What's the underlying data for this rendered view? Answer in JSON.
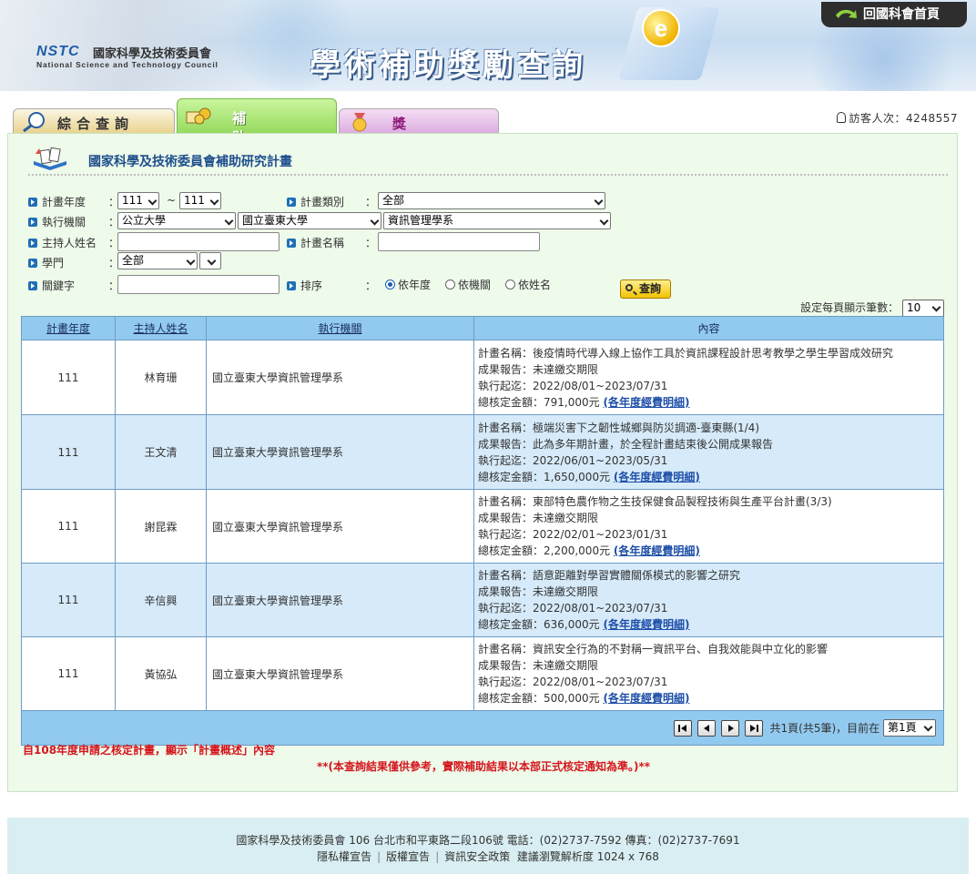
{
  "header": {
    "logo_mark": "NSTC",
    "logo_cn": "國家科學及技術委員會",
    "logo_en": "National Science and Technology Council",
    "site_title": "學術補助獎勵查詢",
    "home_button": "回國科會首頁"
  },
  "tabs": [
    {
      "label": "綜合查詢",
      "icon": "magnifier-icon"
    },
    {
      "label": "補　助",
      "icon": "money-icon"
    },
    {
      "label": "獎　勵",
      "icon": "medal-icon"
    }
  ],
  "visitor": {
    "label": "訪客人次：4248557"
  },
  "panel": {
    "title": "國家科學及技術委員會補助研究計畫"
  },
  "form": {
    "year_label": "計畫年度",
    "year_from": "111",
    "year_sep": "~",
    "year_to": "111",
    "type_label": "計畫類別",
    "type_value": "全部",
    "org_label": "執行機關",
    "org_kind": "公立大學",
    "org_school": "國立臺東大學",
    "org_dept": "資訊管理學系",
    "pi_label": "主持人姓名",
    "pi_value": "",
    "plan_name_label": "計畫名稱",
    "plan_name_value": "",
    "field_label": "學門",
    "field_value": "全部",
    "keyword_label": "關鍵字",
    "keyword_value": "",
    "sort_label": "排序",
    "sort_options": [
      "依年度",
      "依機關",
      "依姓名"
    ],
    "sort_selected": "依年度",
    "search_button": "查詢",
    "colon": "："
  },
  "perpage": {
    "label": "設定每頁顯示筆數：",
    "value": "10"
  },
  "table": {
    "headers": [
      "計畫年度",
      "主持人姓名",
      "執行機關",
      "內容"
    ],
    "rows": [
      {
        "year": "111",
        "pi": "林育珊",
        "org": "國立臺東大學資訊管理學系",
        "plan": "計畫名稱：後疫情時代導入線上協作工具於資訊課程設計思考教學之學生學習成效研究",
        "report": "成果報告：未達繳交期限",
        "period": "執行起迄：2022/08/01~2023/07/31",
        "amount": "總核定金額：791,000元",
        "detail": "(各年度經費明細)"
      },
      {
        "year": "111",
        "pi": "王文清",
        "org": "國立臺東大學資訊管理學系",
        "plan": "計畫名稱：極端災害下之韌性城鄉與防災調適-臺東縣(1/4)",
        "report": "成果報告：此為多年期計畫，於全程計畫結束後公開成果報告",
        "period": "執行起迄：2022/06/01~2023/05/31",
        "amount": "總核定金額：1,650,000元",
        "detail": "(各年度經費明細)"
      },
      {
        "year": "111",
        "pi": "謝昆霖",
        "org": "國立臺東大學資訊管理學系",
        "plan": "計畫名稱：東部特色農作物之生技保健食品製程技術與生產平台計畫(3/3)",
        "report": "成果報告：未達繳交期限",
        "period": "執行起迄：2022/02/01~2023/01/31",
        "amount": "總核定金額：2,200,000元",
        "detail": "(各年度經費明細)"
      },
      {
        "year": "111",
        "pi": "辛信興",
        "org": "國立臺東大學資訊管理學系",
        "plan": "計畫名稱：語意距離對學習實體關係模式的影響之研究",
        "report": "成果報告：未達繳交期限",
        "period": "執行起迄：2022/08/01~2023/07/31",
        "amount": "總核定金額：636,000元",
        "detail": "(各年度經費明細)"
      },
      {
        "year": "111",
        "pi": "黃協弘",
        "org": "國立臺東大學資訊管理學系",
        "plan": "計畫名稱：資訊安全行為的不對稱一資訊平台、自我效能與中立化的影響",
        "report": "成果報告：未達繳交期限",
        "period": "執行起迄：2022/08/01~2023/07/31",
        "amount": "總核定金額：500,000元",
        "detail": "(各年度經費明細)"
      }
    ]
  },
  "pager": {
    "info": "共1頁(共5筆)，目前在",
    "page_select": "第1頁"
  },
  "notes": {
    "red1": "自108年度申請之核定計畫，顯示「計畫概述」內容",
    "red2": "**(本查詢結果僅供參考，實際補助結果以本部正式核定通知為準。)**"
  },
  "footer": {
    "line1": "國家科學及技術委員會  106  台北市和平東路二段106號  電話：(02)2737-7592  傳真：(02)2737-7691",
    "links": [
      "隱私權宣告",
      "版權宣告",
      "資訊安全政策"
    ],
    "resolution": "建議瀏覽解析度 1024 x 768"
  },
  "colors": {
    "accent": "#1e4e8c",
    "table_header": "#92c9ef",
    "row_alt": "#d6eaf9",
    "panel_bg": "#eefaea",
    "note_red": "#d4151d"
  }
}
